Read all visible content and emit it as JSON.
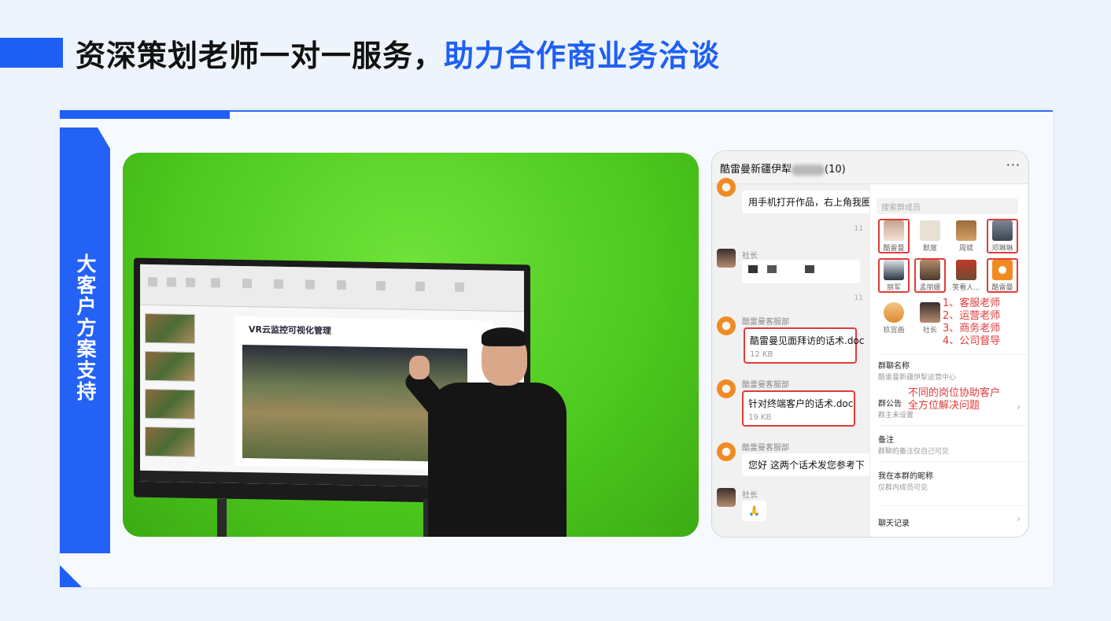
{
  "header": {
    "title_main": "资深策划老师一对一服务，",
    "title_highlight": "助力合作商业务洽谈"
  },
  "card": {
    "side_label": "大客户方案支持"
  },
  "photo": {
    "slide_title": "VR云监控可视化管理"
  },
  "phone": {
    "group_title": "酷雷曼新疆伊犁",
    "group_count": "(10)",
    "more_icon": "···",
    "chat": {
      "msg1": "用手机打开作品，右上角我圈起",
      "time1": "11",
      "nick_shezhang": "社长",
      "time2": "11",
      "nick_kefu1": "酷雷曼客服部",
      "file1_name": "酷雷曼见面拜访的话术.doc",
      "file1_size": "12 KB",
      "nick_kefu2": "酷雷曼客服部",
      "file2_name": "针对终端客户的话术.doc",
      "file2_size": "19 KB",
      "nick_kefu3": "酷雷曼客服部",
      "msg2": "您好 这两个话术发您参考下",
      "nick_shezhang2": "社长",
      "emoji": "🙏"
    },
    "panel": {
      "search_placeholder": "搜索群成员",
      "members": [
        "酷雷曼",
        "默度",
        "周斌",
        "邓琳琳",
        "丽军",
        "孟丽媛",
        "笑看人...",
        "酷雷曼",
        "玖宫画",
        "社长"
      ],
      "roles": [
        "1、客服老师",
        "2、运营老师",
        "3、商务老师",
        "4、公司督导"
      ],
      "group_name_label": "群聊名称",
      "group_name_value": "酷雷曼新疆伊犁运营中心",
      "notice_label": "群公告",
      "notice_value": "群主未设置",
      "annotation": [
        "不同的岗位协助客户",
        "全方位解决问题"
      ],
      "remark_label": "备注",
      "remark_value": "群聊的备注仅自己可见",
      "nickname_label": "我在本群的昵称",
      "nickname_value": "仅群内成员可见",
      "history_label": "聊天记录",
      "chevron": "›"
    }
  }
}
